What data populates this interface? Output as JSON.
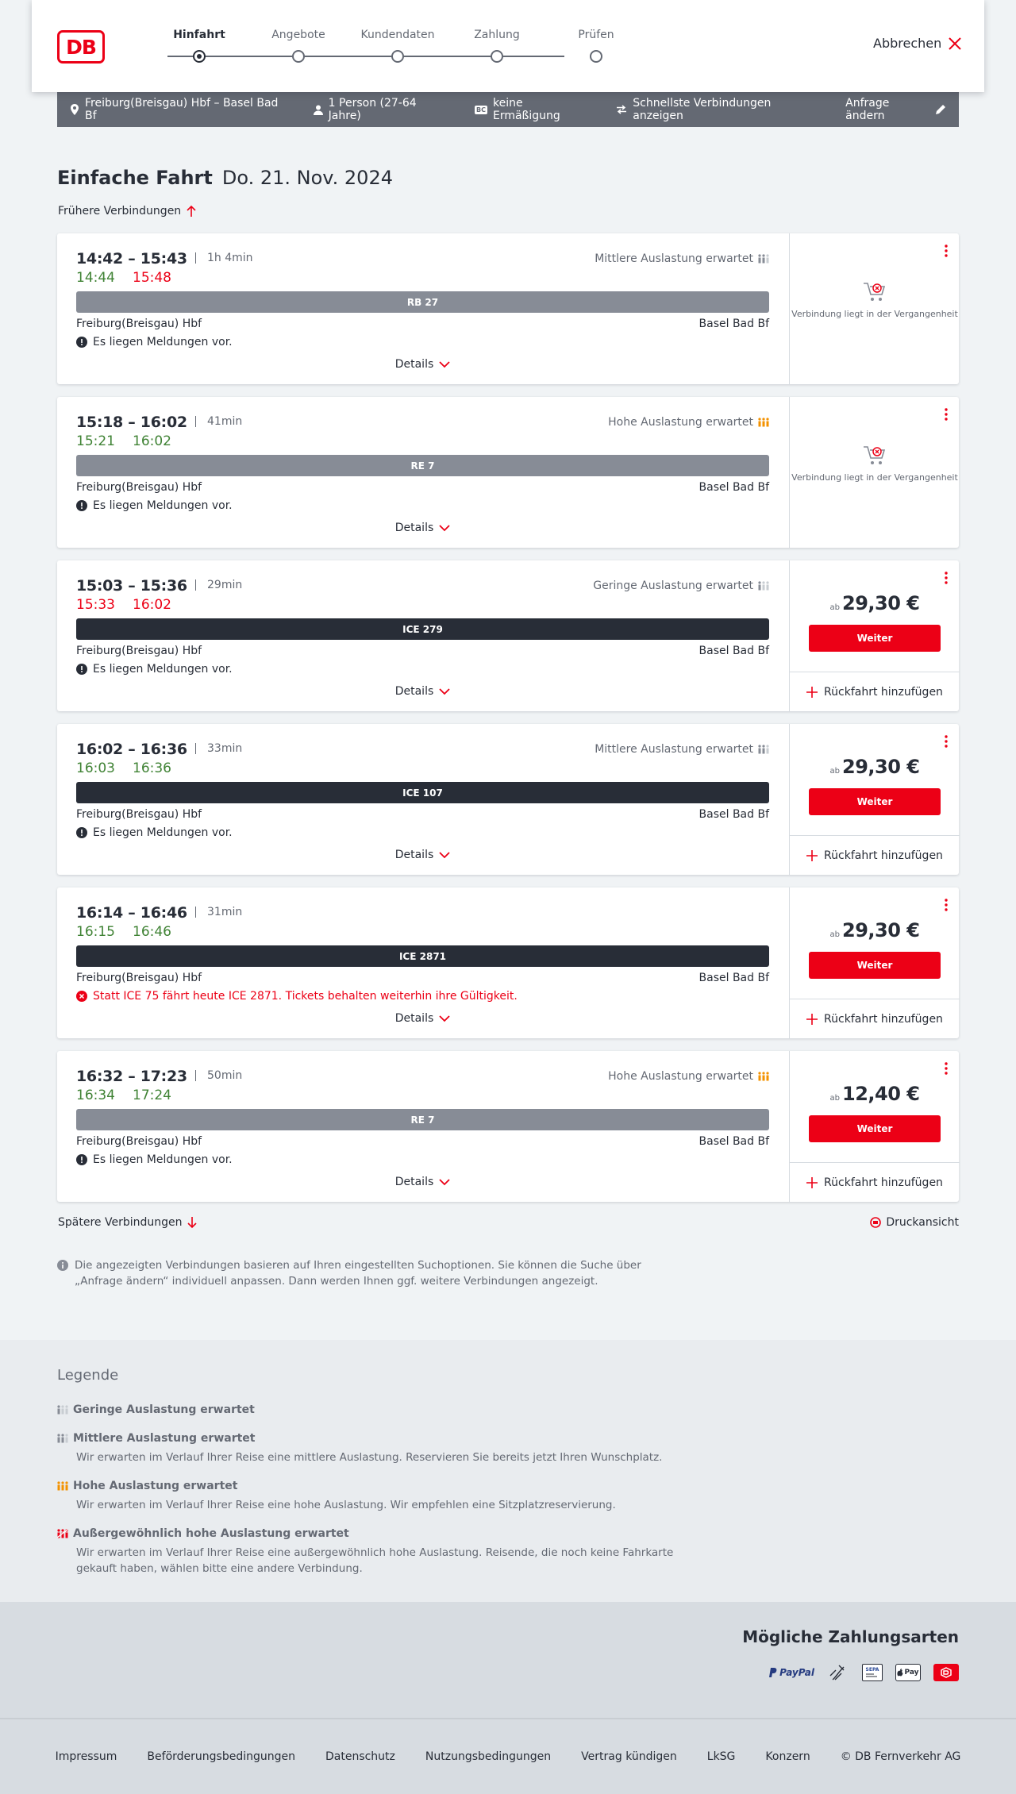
{
  "header": {
    "logo_text": "DB",
    "steps": [
      {
        "label": "Hinfahrt",
        "active": true
      },
      {
        "label": "Angebote",
        "active": false
      },
      {
        "label": "Kundendaten",
        "active": false
      },
      {
        "label": "Zahlung",
        "active": false
      },
      {
        "label": "Prüfen",
        "active": false
      }
    ],
    "cancel_label": "Abbrechen"
  },
  "summary": {
    "route": "Freiburg(Breisgau) Hbf – Basel Bad Bf",
    "passengers": "1 Person (27-64 Jahre)",
    "bahncard_badge": "BC",
    "discount": "keine Ermäßigung",
    "fastest": "Schnellste Verbindungen anzeigen",
    "change": "Anfrage ändern"
  },
  "page": {
    "title_bold": "Einfache Fahrt",
    "title_date": "Do. 21. Nov. 2024",
    "earlier": "Frühere Verbindungen",
    "later": "Spätere Verbindungen",
    "print": "Druckansicht",
    "info": "Die angezeigten Verbindungen basieren auf Ihren eingestellten Suchoptionen. Sie können die Suche über „Anfrage ändern“ individuell anpassen. Dann werden Ihnen ggf. weitere Verbindungen angezeigt."
  },
  "connections": [
    {
      "times": "14:42 – 15:43",
      "duration": "1h 4min",
      "rt_dep": "14:44",
      "rt_dep_color": "g",
      "rt_arr": "15:48",
      "rt_arr_color": "r",
      "occupancy": "Mittlere Auslastung erwartet",
      "occ_level": 2,
      "train": "RB 27",
      "train_style": "grey",
      "from": "Freiburg(Breisgau) Hbf",
      "to": "Basel Bad Bf",
      "message": "Es liegen Meldungen vor.",
      "message_type": "info",
      "details": "Details",
      "past": true,
      "past_text": "Verbindung liegt in der Vergangenheit"
    },
    {
      "times": "15:18 – 16:02",
      "duration": "41min",
      "rt_dep": "15:21",
      "rt_dep_color": "g",
      "rt_arr": "16:02",
      "rt_arr_color": "g",
      "occupancy": "Hohe Auslastung erwartet",
      "occ_level": 3,
      "train": "RE 7",
      "train_style": "grey",
      "from": "Freiburg(Breisgau) Hbf",
      "to": "Basel Bad Bf",
      "message": "Es liegen Meldungen vor.",
      "message_type": "info",
      "details": "Details",
      "past": true,
      "past_text": "Verbindung liegt in der Vergangenheit"
    },
    {
      "times": "15:03 – 15:36",
      "duration": "29min",
      "rt_dep": "15:33",
      "rt_dep_color": "r",
      "rt_arr": "16:02",
      "rt_arr_color": "r",
      "occupancy": "Geringe Auslastung erwartet",
      "occ_level": 1,
      "train": "ICE 279",
      "train_style": "dark",
      "from": "Freiburg(Breisgau) Hbf",
      "to": "Basel Bad Bf",
      "message": "Es liegen Meldungen vor.",
      "message_type": "info",
      "details": "Details",
      "past": false,
      "price_prefix": "ab",
      "price": "29,30 €",
      "button": "Weiter",
      "return": "Rückfahrt hinzufügen"
    },
    {
      "times": "16:02 – 16:36",
      "duration": "33min",
      "rt_dep": "16:03",
      "rt_dep_color": "g",
      "rt_arr": "16:36",
      "rt_arr_color": "g",
      "occupancy": "Mittlere Auslastung erwartet",
      "occ_level": 2,
      "train": "ICE 107",
      "train_style": "dark",
      "from": "Freiburg(Breisgau) Hbf",
      "to": "Basel Bad Bf",
      "message": "Es liegen Meldungen vor.",
      "message_type": "info",
      "details": "Details",
      "past": false,
      "price_prefix": "ab",
      "price": "29,30 €",
      "button": "Weiter",
      "return": "Rückfahrt hinzufügen"
    },
    {
      "times": "16:14 – 16:46",
      "duration": "31min",
      "rt_dep": "16:15",
      "rt_dep_color": "g",
      "rt_arr": "16:46",
      "rt_arr_color": "g",
      "occupancy": "",
      "occ_level": 0,
      "train": "ICE 2871",
      "train_style": "dark",
      "from": "Freiburg(Breisgau) Hbf",
      "to": "Basel Bad Bf",
      "message": "Statt ICE 75 fährt heute ICE 2871. Tickets behalten weiterhin ihre Gültigkeit.",
      "message_type": "error",
      "details": "Details",
      "past": false,
      "price_prefix": "ab",
      "price": "29,30 €",
      "button": "Weiter",
      "return": "Rückfahrt hinzufügen"
    },
    {
      "times": "16:32 – 17:23",
      "duration": "50min",
      "rt_dep": "16:34",
      "rt_dep_color": "g",
      "rt_arr": "17:24",
      "rt_arr_color": "g",
      "occupancy": "Hohe Auslastung erwartet",
      "occ_level": 3,
      "train": "RE 7",
      "train_style": "grey",
      "from": "Freiburg(Breisgau) Hbf",
      "to": "Basel Bad Bf",
      "message": "Es liegen Meldungen vor.",
      "message_type": "info",
      "details": "Details",
      "past": false,
      "price_prefix": "ab",
      "price": "12,40 €",
      "button": "Weiter",
      "return": "Rückfahrt hinzufügen"
    }
  ],
  "legend": {
    "title": "Legende",
    "items": [
      {
        "title": "Geringe Auslastung erwartet",
        "desc": "",
        "level": 1
      },
      {
        "title": "Mittlere Auslastung erwartet",
        "desc": "Wir erwarten im Verlauf Ihrer Reise eine mittlere Auslastung. Reservieren Sie bereits jetzt Ihren Wunschplatz.",
        "level": 2
      },
      {
        "title": "Hohe Auslastung erwartet",
        "desc": "Wir erwarten im Verlauf Ihrer Reise eine hohe Auslastung. Wir empfehlen eine Sitzplatzreservierung.",
        "level": 3
      },
      {
        "title": "Außergewöhnlich hohe Auslastung erwartet",
        "desc": "Wir erwarten im Verlauf Ihrer Reise eine außergewöhnlich hohe Auslastung. Reisende, die noch keine Fahrkarte gekauft haben, wählen bitte eine andere Verbindung.",
        "level": 4
      }
    ]
  },
  "payment": {
    "title": "Mögliche Zahlungsarten",
    "paypal": "PayPal",
    "sepa": "SEPA",
    "applepay": "Pay",
    "icons": [
      "paypal-icon",
      "creditcard-icon",
      "sepa-icon",
      "applepay-icon",
      "db-voucher-icon"
    ]
  },
  "footer": {
    "links": [
      "Impressum",
      "Beförderungsbedingungen",
      "Datenschutz",
      "Nutzungsbedingungen",
      "Vertrag kündigen",
      "LkSG",
      "Konzern",
      "© DB Fernverkehr AG"
    ]
  },
  "colors": {
    "accent": "#ec0016",
    "green": "#408335",
    "dark": "#282d37",
    "grey": "#878c96",
    "orange": "#f39200"
  }
}
